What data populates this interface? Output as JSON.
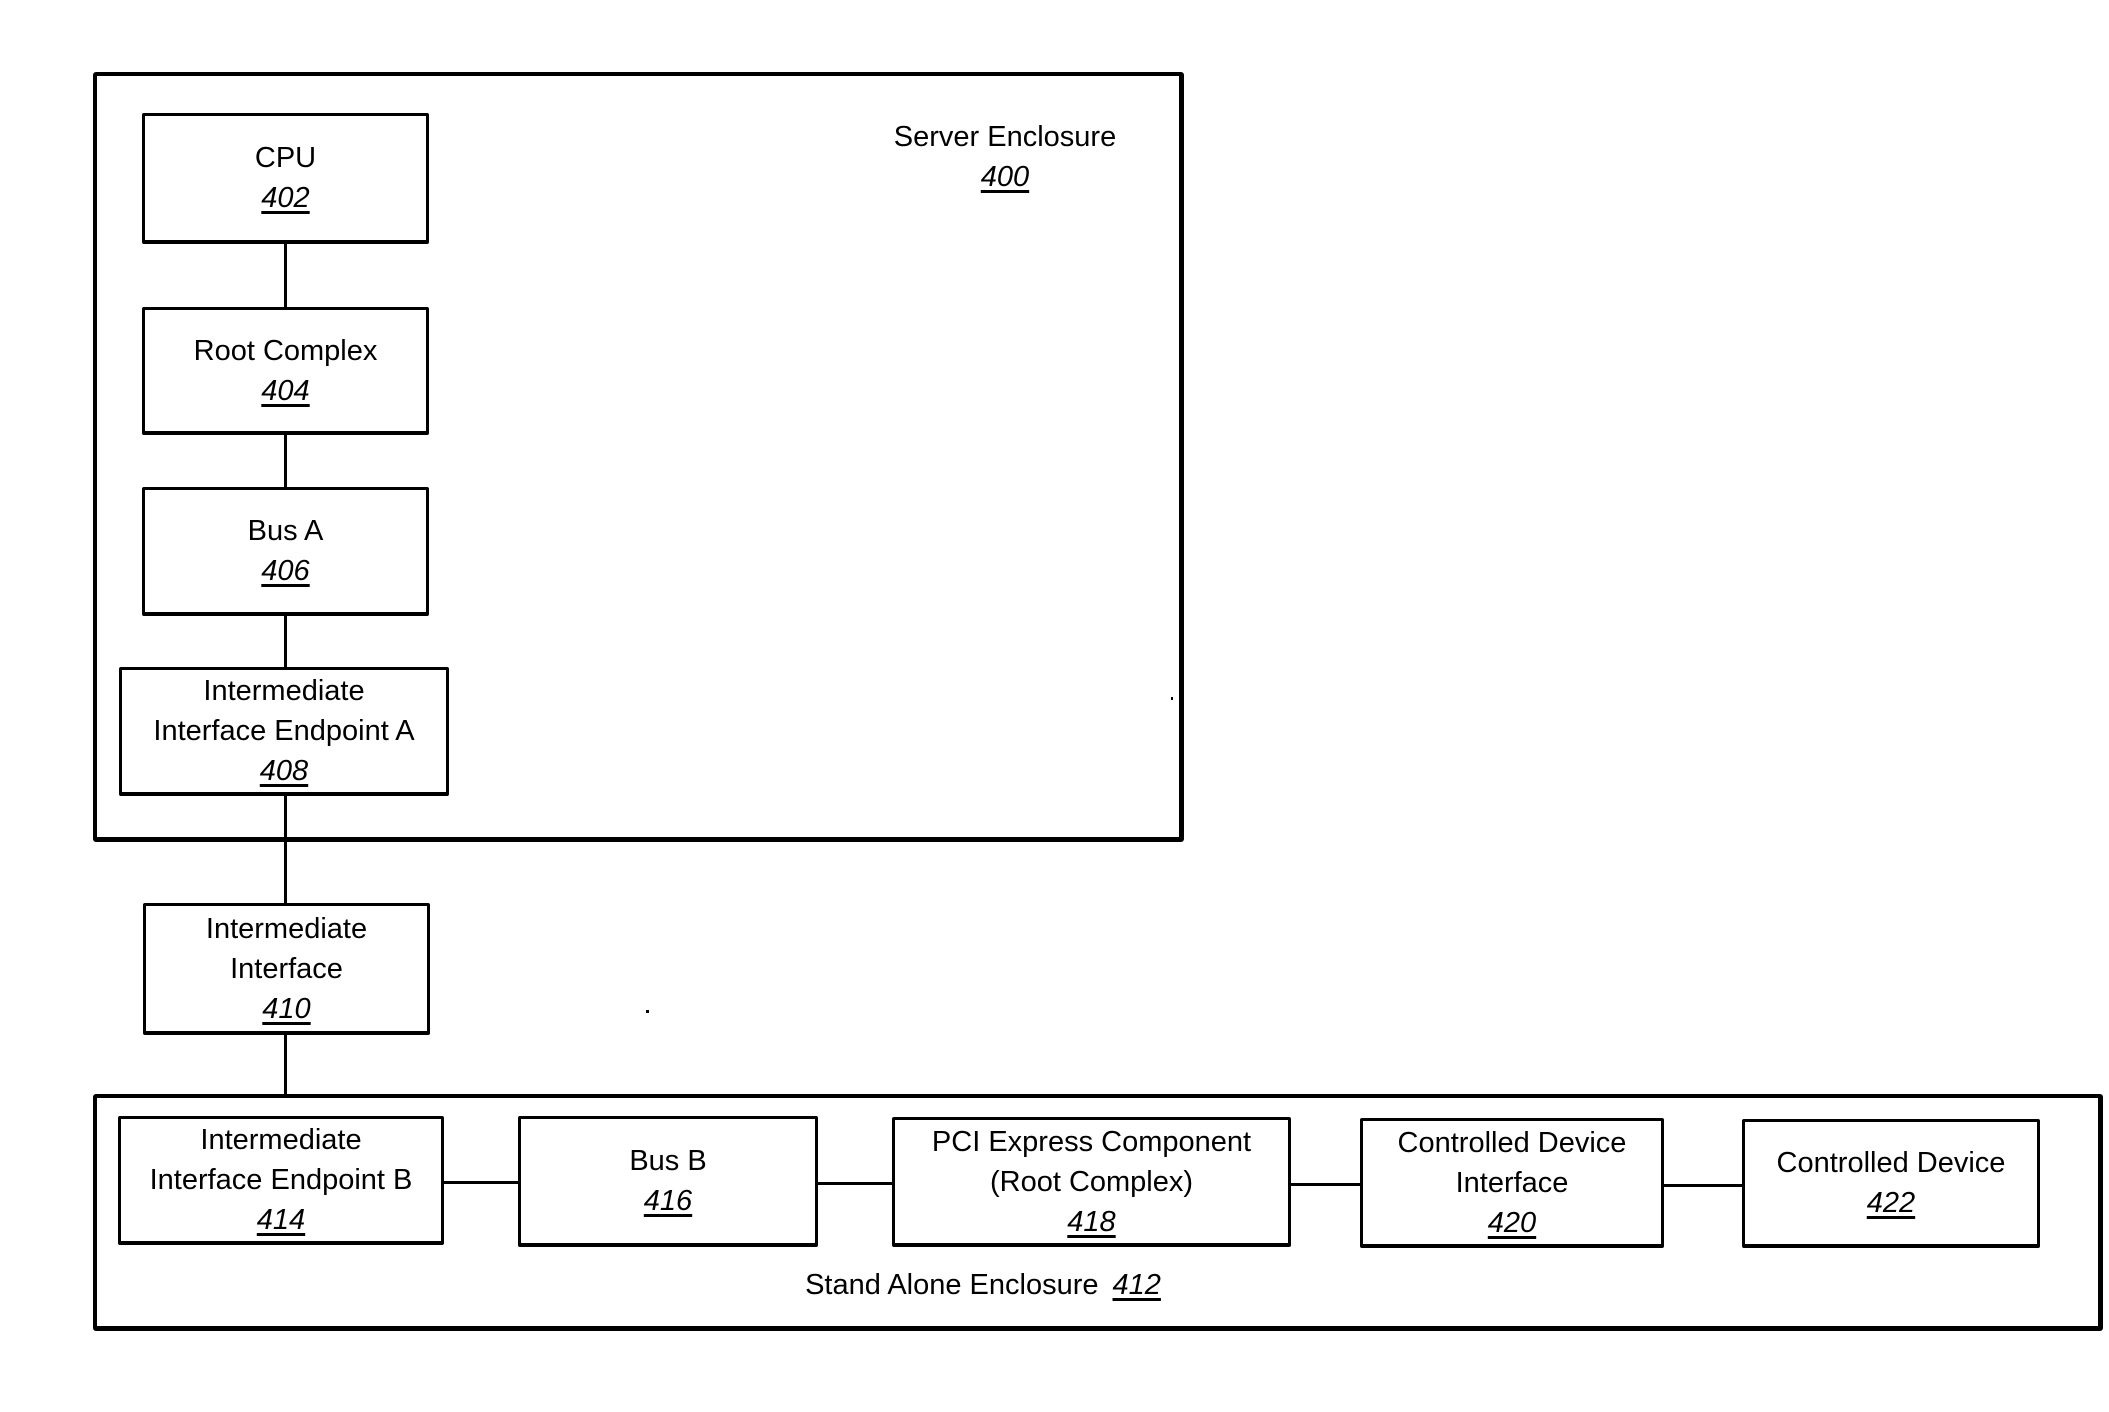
{
  "server_enclosure": {
    "title": "Server Enclosure",
    "ref": "400"
  },
  "stand_alone_enclosure": {
    "title": "Stand Alone Enclosure",
    "ref": "412"
  },
  "components": {
    "cpu": {
      "lines": [
        "CPU"
      ],
      "ref": "402"
    },
    "root_complex": {
      "lines": [
        "Root Complex"
      ],
      "ref": "404"
    },
    "bus_a": {
      "lines": [
        "Bus A"
      ],
      "ref": "406"
    },
    "endpoint_a": {
      "lines": [
        "Intermediate",
        "Interface Endpoint A"
      ],
      "ref": "408"
    },
    "intermediate_interface": {
      "lines": [
        "Intermediate",
        "Interface"
      ],
      "ref": "410"
    },
    "endpoint_b": {
      "lines": [
        "Intermediate",
        "Interface Endpoint B"
      ],
      "ref": "414"
    },
    "bus_b": {
      "lines": [
        "Bus B"
      ],
      "ref": "416"
    },
    "pci_express": {
      "lines": [
        "PCI Express Component",
        "(Root Complex)"
      ],
      "ref": "418"
    },
    "controlled_device_interface": {
      "lines": [
        "Controlled Device",
        "Interface"
      ],
      "ref": "420"
    },
    "controlled_device": {
      "lines": [
        "Controlled Device"
      ],
      "ref": "422"
    }
  },
  "connections": [
    [
      "cpu",
      "root_complex"
    ],
    [
      "root_complex",
      "bus_a"
    ],
    [
      "bus_a",
      "endpoint_a"
    ],
    [
      "endpoint_a",
      "intermediate_interface"
    ],
    [
      "intermediate_interface",
      "endpoint_b"
    ],
    [
      "endpoint_b",
      "bus_b"
    ],
    [
      "bus_b",
      "pci_express"
    ],
    [
      "pci_express",
      "controlled_device_interface"
    ],
    [
      "controlled_device_interface",
      "controlled_device"
    ]
  ]
}
